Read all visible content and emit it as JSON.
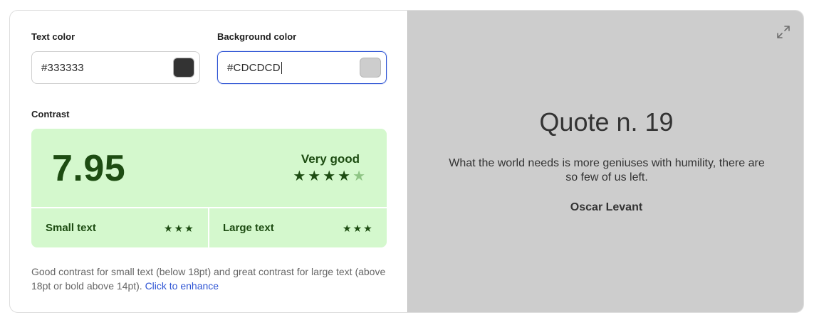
{
  "text_color": {
    "label": "Text color",
    "value": "#333333",
    "swatch": "#333333"
  },
  "background_color": {
    "label": "Background color",
    "value": "#CDCDCD",
    "swatch": "#CDCDCD"
  },
  "contrast": {
    "label": "Contrast",
    "ratio": "7.95",
    "rating": "Very good",
    "stars_filled": 4,
    "stars_total": 5,
    "small_text": {
      "label": "Small text",
      "stars": 3
    },
    "large_text": {
      "label": "Large text",
      "stars": 3
    },
    "description": "Good contrast for small text (below 18pt) and great contrast for large text (above 18pt or bold above 14pt).",
    "enhance_link": "Click to enhance"
  },
  "preview": {
    "title": "Quote n. 19",
    "quote": "What the world needs is more geniuses with humility, there are so few of us left.",
    "author": "Oscar Levant",
    "expand_icon": "expand-icon"
  },
  "colors": {
    "accent": "#2f55d4",
    "contrast_bg": "#d4f8cd",
    "contrast_fg": "#1d4c12",
    "preview_bg": "#cdcdcd",
    "preview_fg": "#333333"
  }
}
